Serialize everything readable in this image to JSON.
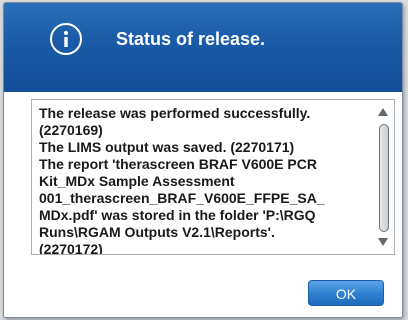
{
  "dialog": {
    "title": "Status of release.",
    "icon": "info-icon",
    "message_lines": [
      "The release was performed successfully.",
      "(2270169)",
      "The LIMS output was saved. (2270171)",
      "The report 'therascreen BRAF V600E PCR",
      "Kit_MDx Sample Assessment",
      "001_therascreen_BRAF_V600E_FFPE_SA_",
      "MDx.pdf' was stored in the folder 'P:\\RGQ",
      "Runs\\RGAM Outputs V2.1\\Reports'.",
      "(2270172)"
    ],
    "ok_label": "OK"
  },
  "colors": {
    "header": "#1a5aa6",
    "button": "#2f7fd0",
    "text": "#1a1a1a"
  }
}
